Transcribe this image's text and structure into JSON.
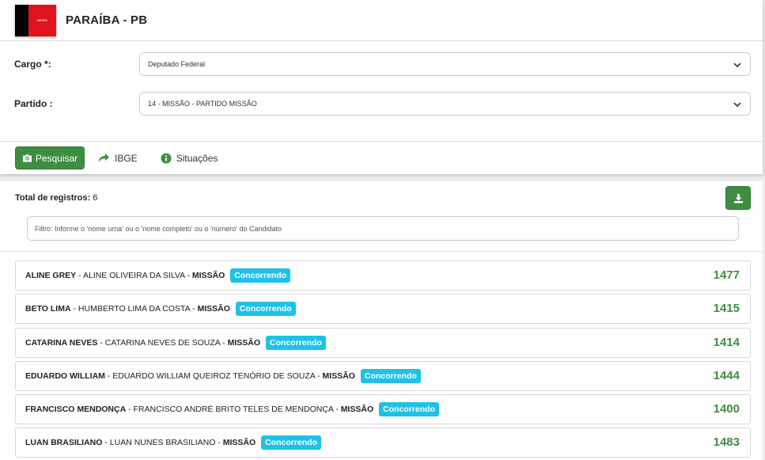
{
  "header": {
    "flag_text": "NEGO",
    "title": "PARAÍBA - PB"
  },
  "form": {
    "cargo": {
      "label": "Cargo *:",
      "value": "Deputado Federal"
    },
    "partido": {
      "label": "Partido :",
      "value": "14 - MISSÃO - PARTIDO MISSÃO"
    }
  },
  "actions": {
    "pesquisar": "Pesquisar",
    "ibge": "IBGE",
    "situacoes": "Situações"
  },
  "results": {
    "total_label": "Total de registros:",
    "total_value": "6",
    "filter_placeholder": "Filtro: Informe o 'nome urna' ou o 'nome completo' ou o 'número' do Candidato"
  },
  "candidates": [
    {
      "urna": "ALINE GREY",
      "full": "ALINE OLIVEIRA DA SILVA",
      "party": "MISSÃO",
      "status": "Concorrendo",
      "number": "1477"
    },
    {
      "urna": "BETO LIMA",
      "full": "HUMBERTO LIMA DA COSTA",
      "party": "MISSÃO",
      "status": "Concorrendo",
      "number": "1415"
    },
    {
      "urna": "CATARINA NEVES",
      "full": "CATARINA NEVES DE SOUZA",
      "party": "MISSÃO",
      "status": "Concorrendo",
      "number": "1414"
    },
    {
      "urna": "EDUARDO WILLIAM",
      "full": "EDUARDO WILLIAM QUEIROZ TENÓRIO DE SOUZA",
      "party": "MISSÃO",
      "status": "Concorrendo",
      "number": "1444"
    },
    {
      "urna": "FRANCISCO MENDONÇA",
      "full": "FRANCISCO ANDRÉ BRITO TELES DE MENDONÇA",
      "party": "MISSÃO",
      "status": "Concorrendo",
      "number": "1400"
    },
    {
      "urna": "LUAN BRASILIANO",
      "full": "LUAN NUNES BRASILIANO",
      "party": "MISSÃO",
      "status": "Concorrendo",
      "number": "1483"
    }
  ],
  "sep": " - ",
  "colors": {
    "primary_green": "#3e8e41",
    "badge_cyan": "#1ec2e8",
    "flag_red": "#e0141e"
  }
}
